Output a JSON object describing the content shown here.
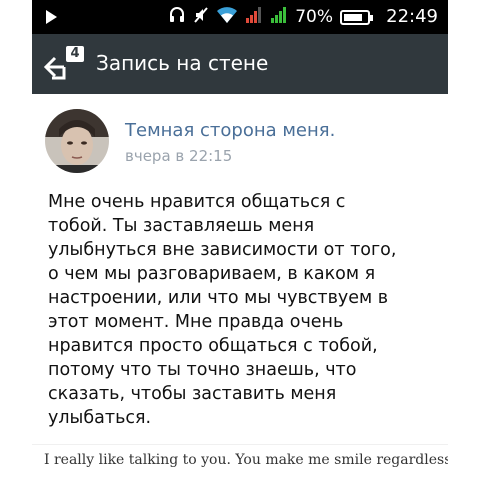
{
  "status_bar": {
    "battery_percent": "70%",
    "time": "22:49",
    "icons": [
      "play-icon",
      "headset-icon",
      "mute-icon",
      "wifi-icon",
      "signal-icon",
      "signal-icon",
      "battery-icon"
    ]
  },
  "action_bar": {
    "title": "Запись на стене",
    "back_badge": "4"
  },
  "post": {
    "author": "Темная сторона меня.",
    "time": "вчера в 22:15",
    "text": "Мне очень нравится общаться с\nтобой. Ты заставляешь меня\nулыбнуться вне зависимости от того,\nо чем мы разговариваем, в каком я\nнастроении, или что мы чувствуем в\nэтот момент. Мне правда очень\nнравится просто общаться с тобой,\nпотому что ты точно знаешь, что\nсказать, чтобы заставить меня\nулыбаться."
  },
  "caption": "I really like talking to you. You make me smile regardless of",
  "colors": {
    "action_bar": "#30383d",
    "link": "#4a6f98",
    "meta": "#9aa3ad"
  }
}
